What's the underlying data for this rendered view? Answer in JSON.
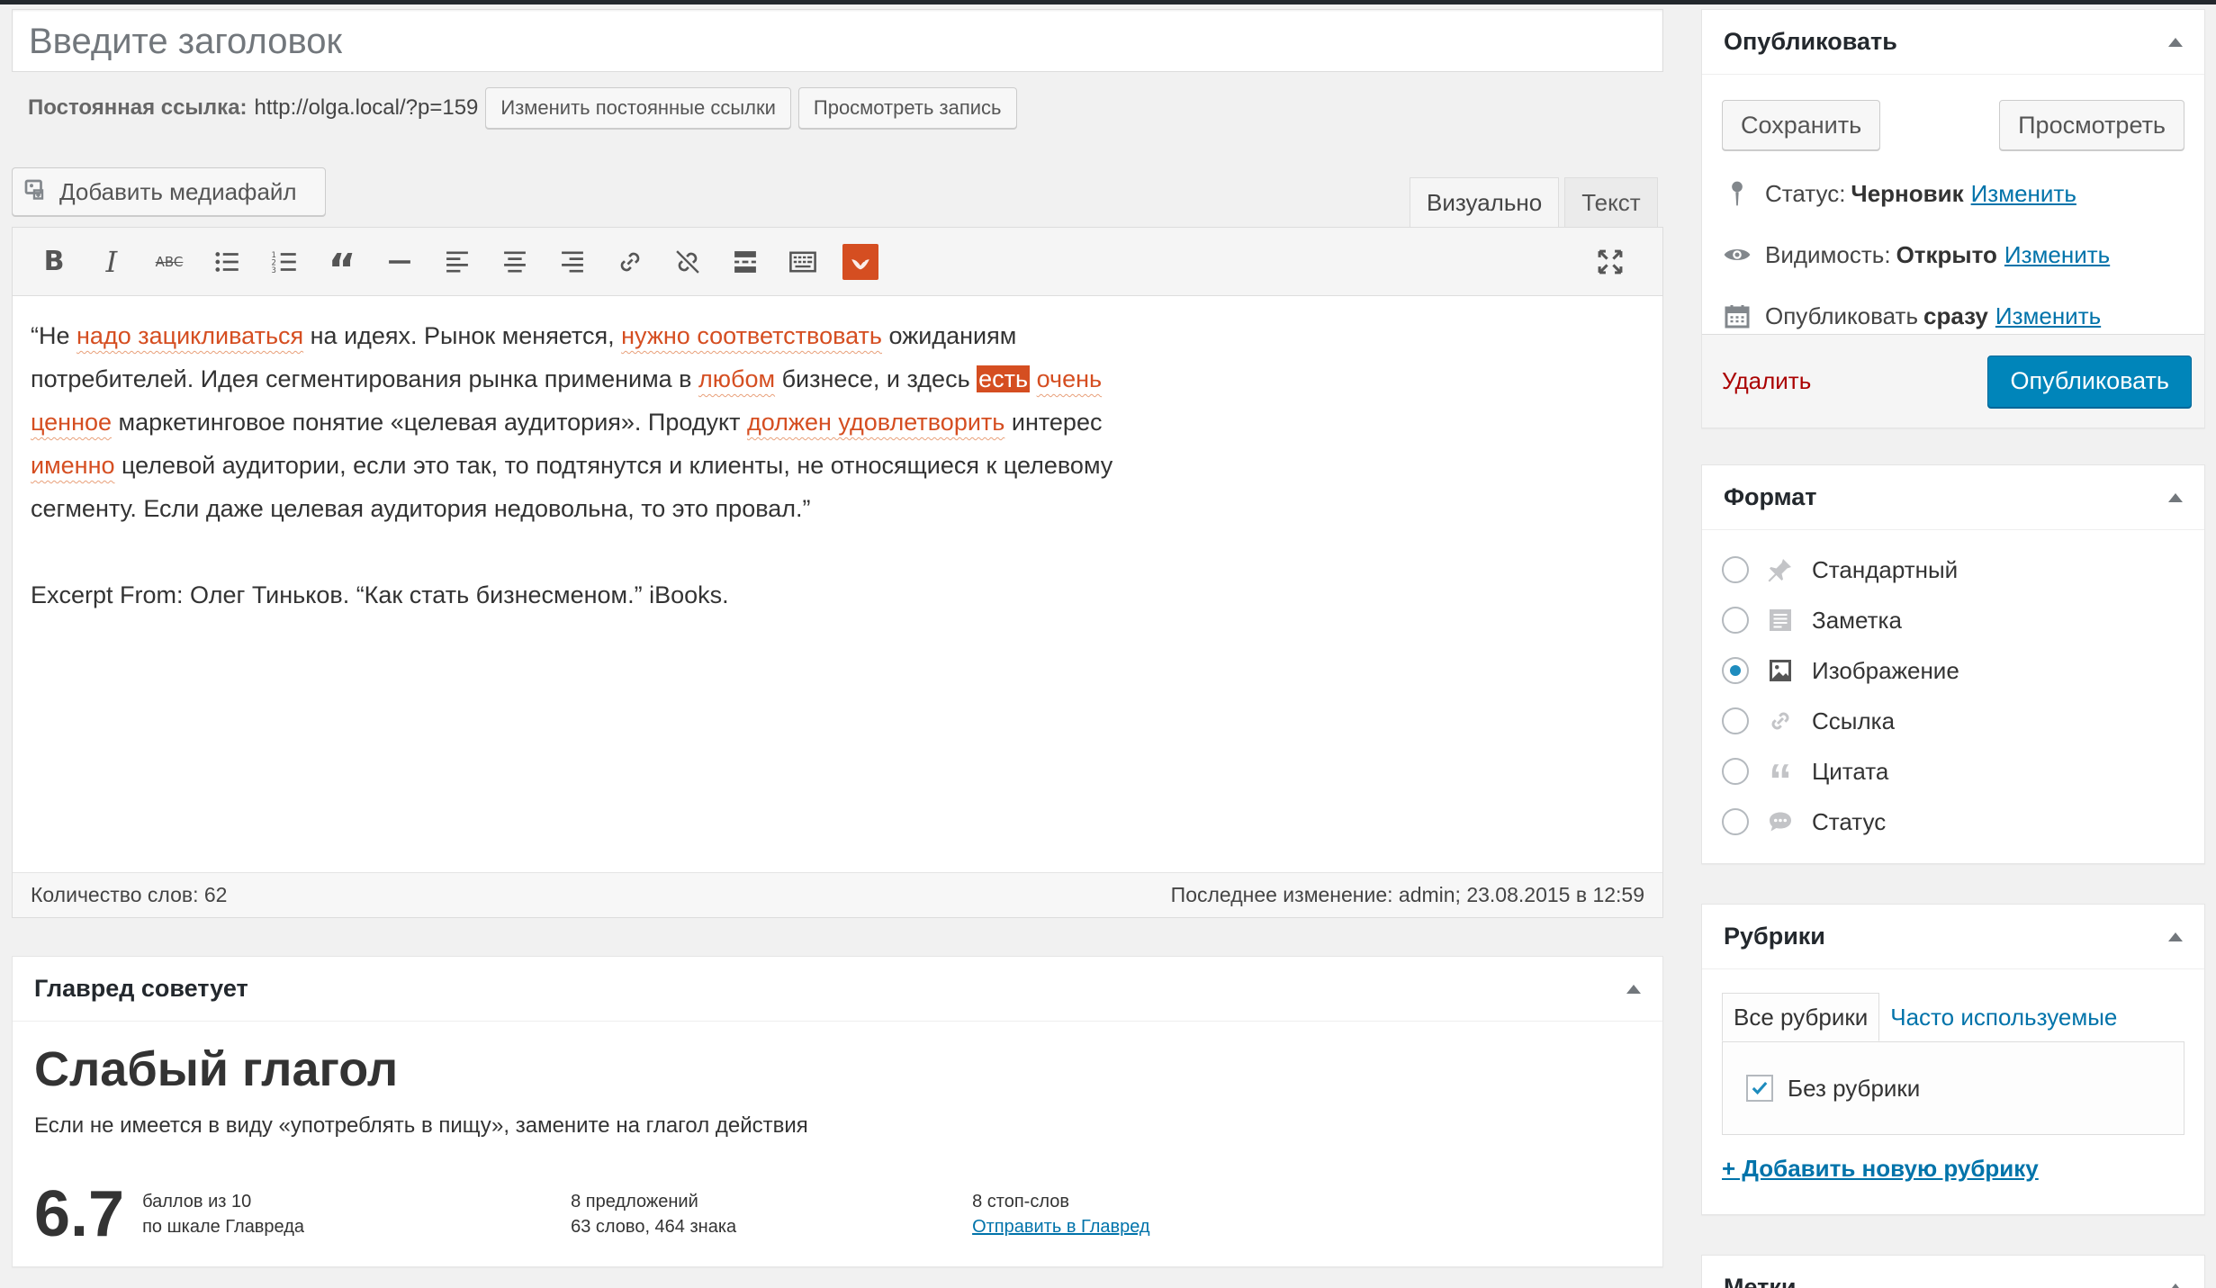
{
  "title": {
    "placeholder": "Введите заголовок"
  },
  "permalink": {
    "label": "Постоянная ссылка:",
    "url": "http://olga.local/?p=159",
    "change_button": "Изменить постоянные ссылки",
    "view_button": "Просмотреть запись"
  },
  "media_button": "Добавить медиафайл",
  "editor_tabs": {
    "visual": "Визуально",
    "text": "Текст"
  },
  "toolbar": {
    "icons": [
      "bold-icon",
      "italic-icon",
      "strikethrough-icon",
      "bullet-list-icon",
      "numbered-list-icon",
      "blockquote-icon",
      "horizontal-line-icon",
      "align-left-icon",
      "align-center-icon",
      "align-right-icon",
      "insert-link-icon",
      "remove-link-icon",
      "read-more-icon",
      "toolbar-toggle-icon",
      "glavred-plugin-icon",
      "fullscreen-icon"
    ],
    "bold": "B",
    "italic": "I",
    "strike": "ABC",
    "quote": "“"
  },
  "content": {
    "p1": [
      {
        "t": "“Не "
      },
      {
        "t": "надо зацикливаться",
        "hl": 1
      },
      {
        "t": " на идеях. Рынок меняется, "
      },
      {
        "t": "нужно соответствовать",
        "hl": 1
      },
      {
        "t": " ожиданиям потребителей. Идея сегментирования рынка применима в "
      },
      {
        "t": "любом",
        "hl": 1
      },
      {
        "t": " бизнесе, и здесь "
      },
      {
        "t": "есть",
        "hl": 2
      },
      {
        "t": " "
      },
      {
        "t": "очень ценное",
        "hl": 1
      },
      {
        "t": " маркетинговое понятие «целевая аудитория». Продукт "
      },
      {
        "t": "должен удовлетворить",
        "hl": 1
      },
      {
        "t": " интерес "
      },
      {
        "t": "именно",
        "hl": 1
      },
      {
        "t": " целевой аудитории, если это так, то подтянутся и клиенты, не относящиеся к целевому сегменту. Если даже целевая аудитория недовольна, то это провал.”"
      }
    ],
    "p2": "Excerpt From: Олег Тиньков. “Как стать бизнесменом.” iBooks."
  },
  "status": {
    "word_count": "Количество слов: 62",
    "last_edit": "Последнее изменение: admin; 23.08.2015 в 12:59"
  },
  "glavred": {
    "header": "Главред советует",
    "heading": "Слабый глагол",
    "description": "Если не имеется в виду «употреблять в пищу», замените на глагол действия",
    "score": "6.7",
    "score_line1": "баллов из 10",
    "score_line2": "по шкале Главреда",
    "sentences": "8 предложений",
    "words": "63 слово, 464 знака",
    "stopwords": "8 стоп-слов",
    "send_link": "Отправить в Главред"
  },
  "publish": {
    "header": "Опубликовать",
    "save": "Сохранить",
    "preview": "Просмотреть",
    "status_label": "Статус:",
    "status_value": "Черновик",
    "visibility_label": "Видимость:",
    "visibility_value": "Открыто",
    "publish_label": "Опубликовать",
    "publish_value": "сразу",
    "edit": "Изменить",
    "delete": "Удалить",
    "publish_button": "Опубликовать"
  },
  "format": {
    "header": "Формат",
    "options": [
      {
        "label": "Стандартный",
        "icon": "pin-icon",
        "selected": false
      },
      {
        "label": "Заметка",
        "icon": "note-icon",
        "selected": false
      },
      {
        "label": "Изображение",
        "icon": "image-icon",
        "selected": true
      },
      {
        "label": "Ссылка",
        "icon": "link-icon",
        "selected": false
      },
      {
        "label": "Цитата",
        "icon": "quote-icon",
        "selected": false
      },
      {
        "label": "Статус",
        "icon": "chat-icon",
        "selected": false
      }
    ]
  },
  "categories": {
    "header": "Рубрики",
    "tab_all": "Все рубрики",
    "tab_popular": "Часто используемые",
    "item": "Без рубрики",
    "item_checked": true,
    "add_new": "+ Добавить новую рубрику"
  },
  "tags": {
    "header": "Метки"
  },
  "colors": {
    "accent": "#0085ba",
    "highlight": "#d54e21",
    "delete": "#aa0000"
  }
}
